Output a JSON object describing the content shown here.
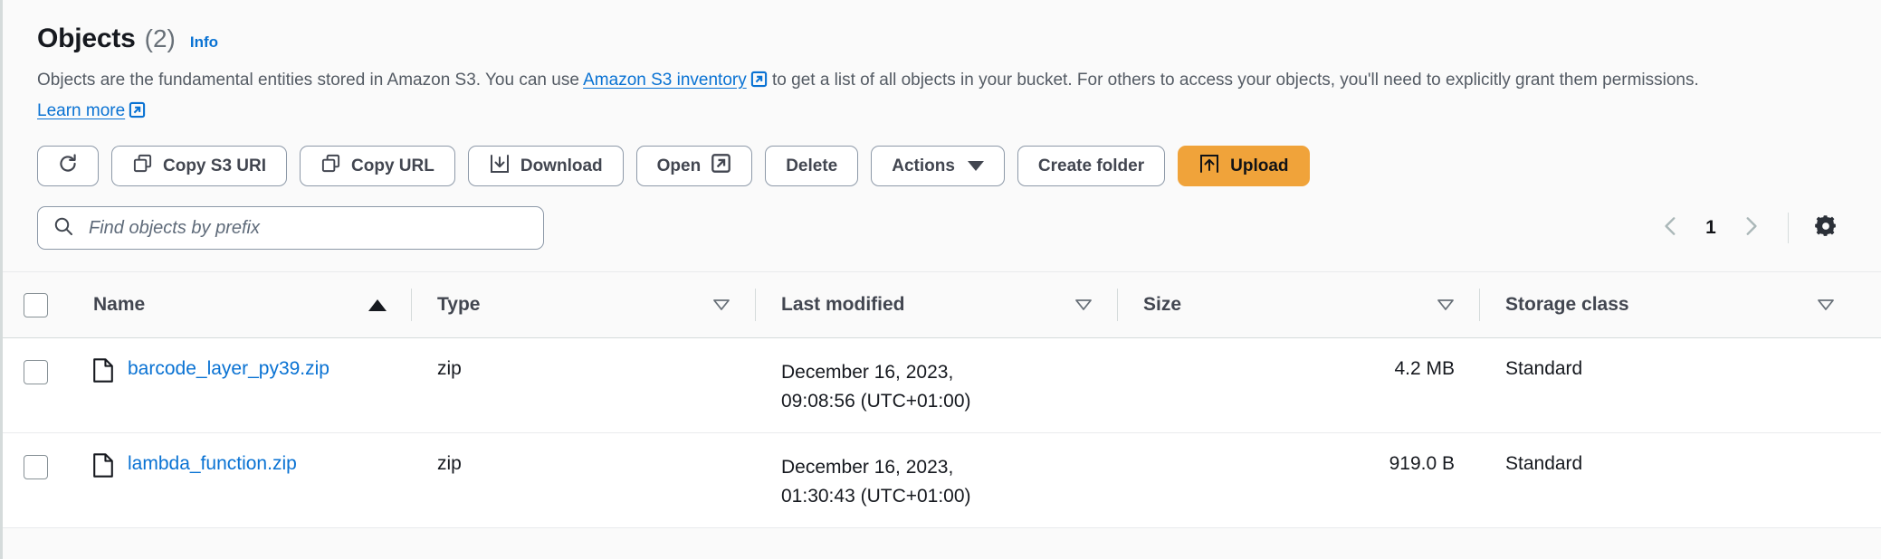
{
  "header": {
    "title": "Objects",
    "count": "(2)",
    "info_label": "Info",
    "description_part1": "Objects are the fundamental entities stored in Amazon S3. You can use",
    "inventory_link": "Amazon S3 inventory",
    "description_part2": "to get a list of all objects in your bucket. For others to access your objects, you'll need to explicitly grant them permissions.",
    "learn_more_link": "Learn more"
  },
  "toolbar": {
    "refresh_icon": "refresh-icon",
    "copy_s3_uri": "Copy S3 URI",
    "copy_url": "Copy URL",
    "download": "Download",
    "open": "Open",
    "delete": "Delete",
    "actions": "Actions",
    "create_folder": "Create folder",
    "upload": "Upload"
  },
  "search": {
    "placeholder": "Find objects by prefix",
    "value": ""
  },
  "pagination": {
    "previous_icon": "chevron-left-icon",
    "page": "1",
    "next_icon": "chevron-right-icon",
    "settings_icon": "gear-icon"
  },
  "table": {
    "columns": [
      {
        "label": "Name",
        "sort": "asc"
      },
      {
        "label": "Type",
        "sort": "none"
      },
      {
        "label": "Last modified",
        "sort": "none"
      },
      {
        "label": "Size",
        "sort": "none"
      },
      {
        "label": "Storage class",
        "sort": "none"
      }
    ],
    "rows": [
      {
        "name": "barcode_layer_py39.zip",
        "type": "zip",
        "last_modified": "December 16, 2023,\n09:08:56 (UTC+01:00)",
        "size": "4.2 MB",
        "storage_class": "Standard",
        "selected": false
      },
      {
        "name": "lambda_function.zip",
        "type": "zip",
        "last_modified": "December 16, 2023,\n01:30:43 (UTC+01:00)",
        "size": "919.0 B",
        "storage_class": "Standard",
        "selected": false
      }
    ]
  },
  "colors": {
    "link": "#0972d3",
    "primary_button": "#f0a33a",
    "text": "#16191f",
    "muted_text": "#545b64",
    "border": "#8d99a8"
  }
}
